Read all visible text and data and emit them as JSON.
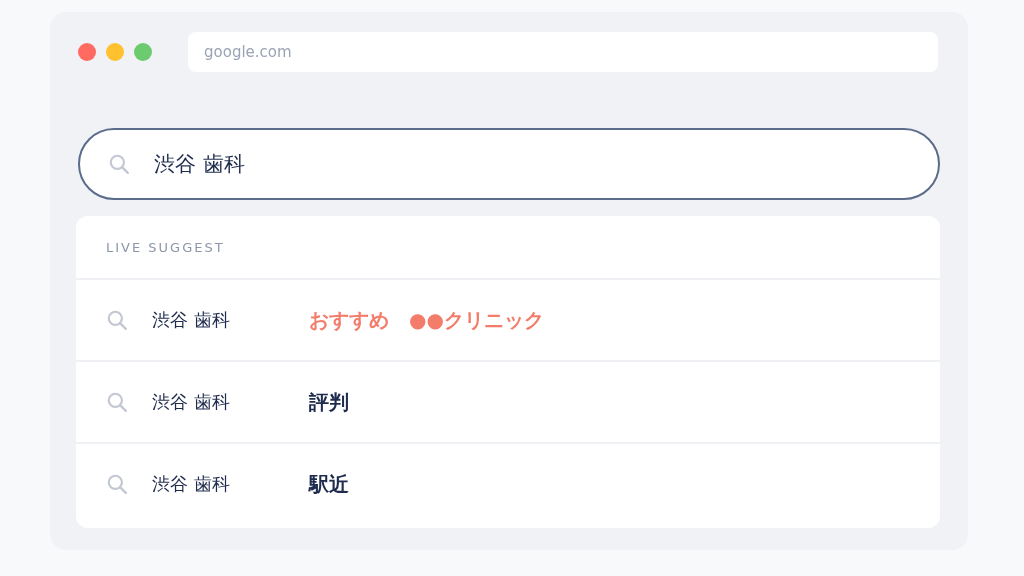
{
  "browser": {
    "address": "google.com"
  },
  "search": {
    "value": "渋谷 歯科"
  },
  "suggest": {
    "heading": "LIVE SUGGEST",
    "items": [
      {
        "query": "渋谷 歯科",
        "suffix": "おすすめ　●●クリニック",
        "highlighted": true
      },
      {
        "query": "渋谷 歯科",
        "suffix": "評判",
        "highlighted": false
      },
      {
        "query": "渋谷 歯科",
        "suffix": "駅近",
        "highlighted": false
      }
    ]
  }
}
